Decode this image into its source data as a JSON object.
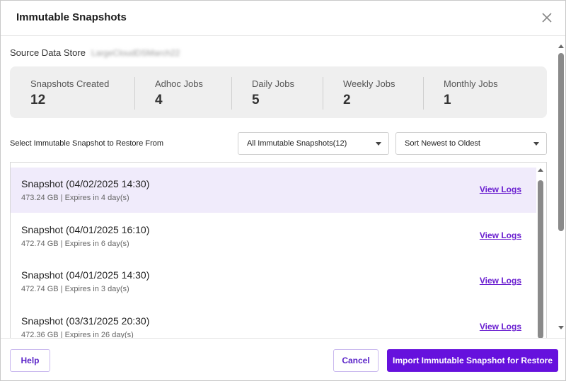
{
  "modal": {
    "title": "Immutable Snapshots"
  },
  "source": {
    "label": "Source Data Store",
    "value": "LargeCloudDSMarch22"
  },
  "stats": [
    {
      "label": "Snapshots Created",
      "value": "12"
    },
    {
      "label": "Adhoc Jobs",
      "value": "4"
    },
    {
      "label": "Daily Jobs",
      "value": "5"
    },
    {
      "label": "Weekly Jobs",
      "value": "2"
    },
    {
      "label": "Monthly Jobs",
      "value": "1"
    }
  ],
  "selection": {
    "label": "Select Immutable Snapshot to Restore From",
    "filter_value": "All Immutable Snapshots(12)",
    "sort_value": "Sort Newest to Oldest"
  },
  "snapshots": [
    {
      "title": "Snapshot (04/02/2025 14:30)",
      "details": "473.24 GB | Expires in 4 day(s)",
      "link": "View Logs",
      "selected": true
    },
    {
      "title": "Snapshot (04/01/2025 16:10)",
      "details": "472.74 GB | Expires in 6 day(s)",
      "link": "View Logs",
      "selected": false
    },
    {
      "title": "Snapshot (04/01/2025 14:30)",
      "details": "472.74 GB | Expires in 3 day(s)",
      "link": "View Logs",
      "selected": false
    },
    {
      "title": "Snapshot (03/31/2025 20:30)",
      "details": "472.36 GB | Expires in 26 day(s)",
      "link": "View Logs",
      "selected": false
    }
  ],
  "footer": {
    "help_label": "Help",
    "cancel_label": "Cancel",
    "import_label": "Import Immutable Snapshot for Restore"
  },
  "colors": {
    "accent": "#6611dd",
    "selected_row": "#f0ebfb",
    "stats_background": "#efefef"
  },
  "icons": {
    "close": "close-icon",
    "dropdown": "chevron-down-icon"
  }
}
